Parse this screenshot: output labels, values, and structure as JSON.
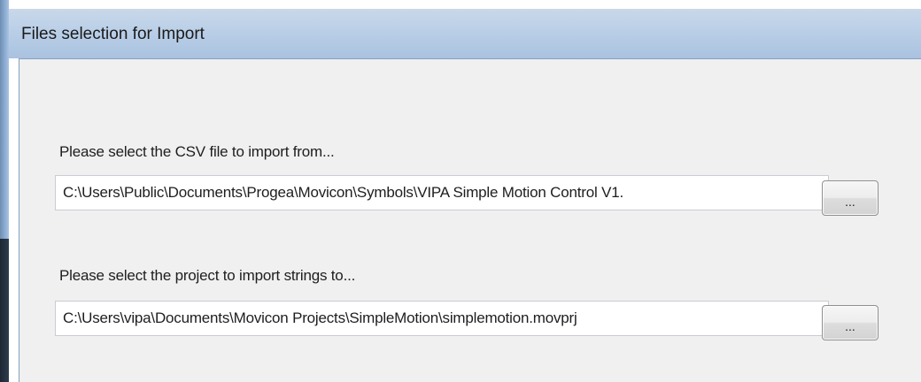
{
  "window": {
    "title": "Files selection for Import"
  },
  "csv_section": {
    "label": "Please select the CSV file to import from...",
    "path": "C:\\Users\\Public\\Documents\\Progea\\Movicon\\Symbols\\VIPA Simple Motion Control V1.",
    "browse_label": "..."
  },
  "project_section": {
    "label": "Please select the project to import strings to...",
    "path": "C:\\Users\\vipa\\Documents\\Movicon Projects\\SimpleMotion\\simplemotion.movprj",
    "browse_label": "..."
  }
}
